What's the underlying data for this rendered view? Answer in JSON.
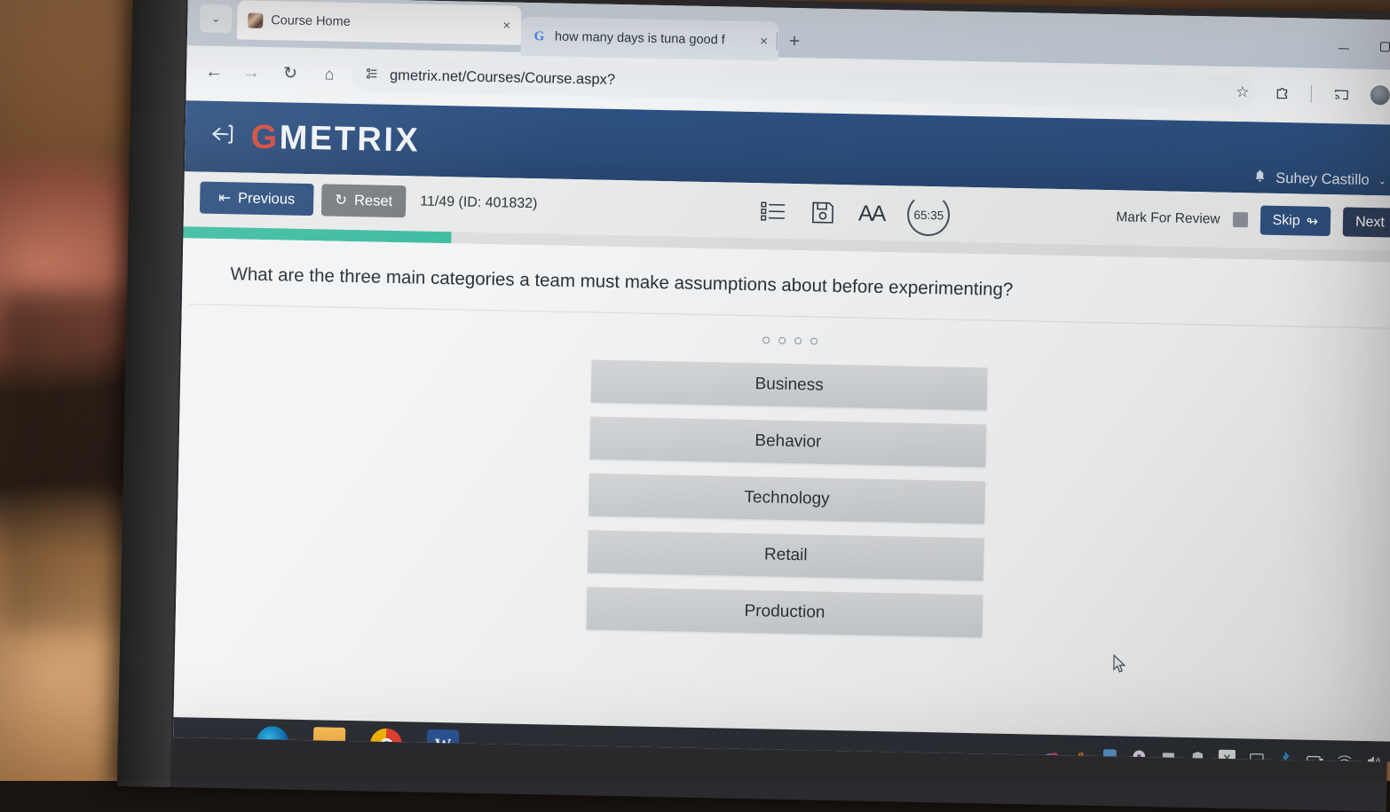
{
  "browser": {
    "tabs": [
      {
        "title": "Course Home",
        "favicon": "course-favicon",
        "close": "×"
      },
      {
        "title": "how many days is tuna good f",
        "favicon": "G",
        "close": "×"
      }
    ],
    "new_tab_label": "+",
    "tablist_chevron": "⌄",
    "nav": {
      "back": "←",
      "forward": "→",
      "reload": "↻",
      "home": "⌂"
    },
    "address": {
      "permission_icon": "site-permissions-icon",
      "url": "gmetrix.net/Courses/Course.aspx?"
    },
    "toolbar_icons": {
      "bookmark": "☆",
      "extensions": "extensions-puzzle-icon",
      "cast": "cast-icon",
      "profile": "profile-avatar"
    },
    "window_controls": {
      "minimize": "minimize",
      "maximize": "maximize"
    }
  },
  "app": {
    "logo_prefix": "G",
    "logo_rest": "METRIX",
    "back_arrow": "↤",
    "user": {
      "bell": "🔔",
      "name": "Suhey Castillo",
      "caret": "⌄"
    },
    "accent_blue": "#2f5180",
    "progress_color": "#3fbda2",
    "toolbar": {
      "previous_label": "Previous",
      "previous_icon": "⇤",
      "reset_label": "Reset",
      "reset_icon": "↻",
      "question_counter": "11/49 (ID: 401832)",
      "list_icon": "question-list-icon",
      "save_icon": "save-floppy-icon",
      "font_size_label": "AA",
      "timer_value": "65:35",
      "mark_for_review_label": "Mark For Review",
      "skip_label": "Skip",
      "skip_icon": "↬",
      "next_label": "Next",
      "next_icon": "→"
    },
    "progress_percent": 22,
    "question": {
      "text": "What are the three main categories a team must make assumptions about before experimenting?",
      "dots": 4,
      "options": [
        {
          "label": "Business"
        },
        {
          "label": "Behavior"
        },
        {
          "label": "Technology"
        },
        {
          "label": "Retail"
        },
        {
          "label": "Production"
        }
      ]
    }
  },
  "taskbar": {
    "apps": [
      {
        "name": "start-button",
        "label": ""
      },
      {
        "name": "edge-icon",
        "label": ""
      },
      {
        "name": "file-explorer-icon",
        "label": ""
      },
      {
        "name": "chrome-icon",
        "label": ""
      },
      {
        "name": "word-icon",
        "label": "W"
      }
    ],
    "tray": [
      "onedrive-icon",
      "internet-explorer-icon",
      "app-blue-icon",
      "media-icon",
      "installer-icon",
      "security-shield-icon",
      "excel-icon",
      "display-icon",
      "bluetooth-icon",
      "battery-icon",
      "wifi-icon",
      "volume-icon"
    ]
  }
}
